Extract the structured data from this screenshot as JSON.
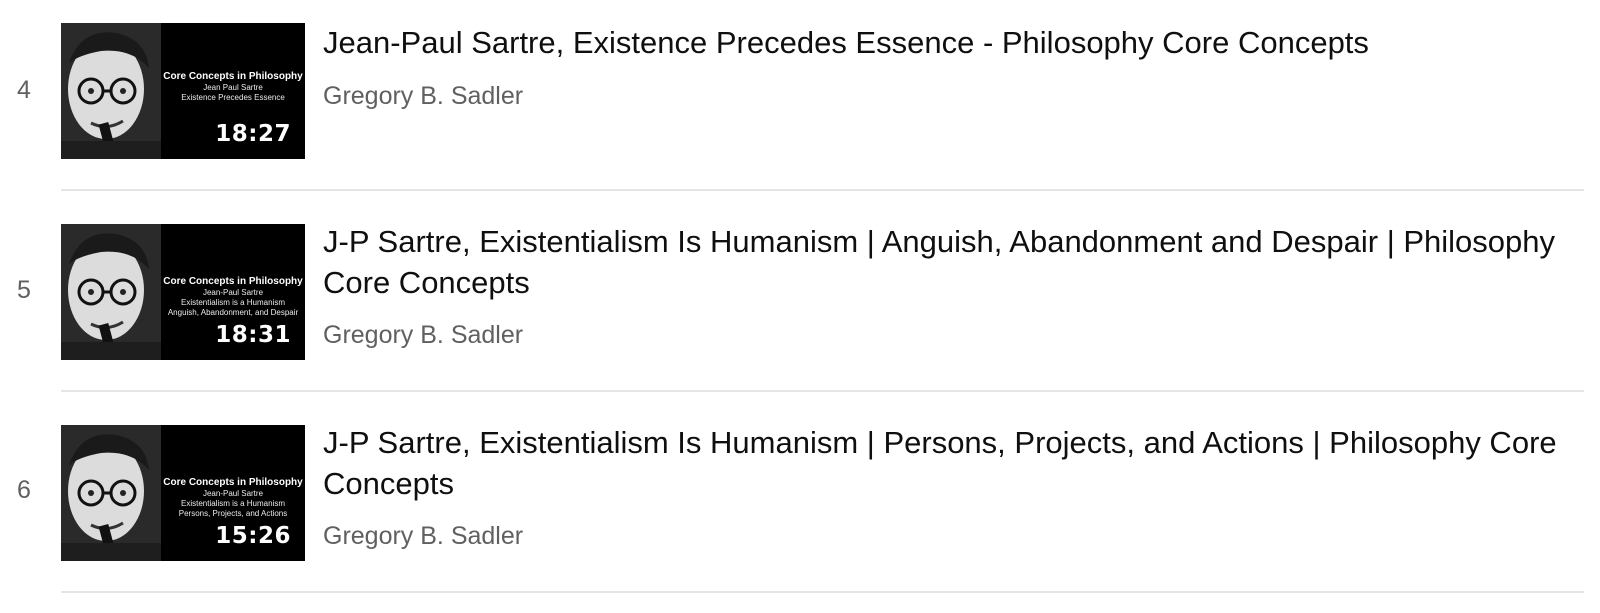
{
  "playlist": {
    "items": [
      {
        "index": "4",
        "title": "Jean-Paul Sartre, Existence Precedes Essence - Philosophy Core Concepts",
        "channel": "Gregory B. Sadler",
        "duration": "18:27",
        "thumbnail": {
          "series": "Core Concepts in Philosophy",
          "lines": [
            "Jean Paul Sartre",
            "Existence Precedes Essence"
          ]
        }
      },
      {
        "index": "5",
        "title": "J-P Sartre, Existentialism Is Humanism | Anguish, Abandonment and Despair | Philosophy Core Concepts",
        "channel": "Gregory B. Sadler",
        "duration": "18:31",
        "thumbnail": {
          "series": "Core Concepts in Philosophy",
          "lines": [
            "Jean-Paul Sartre",
            "Existentialism is a Humanism",
            "Anguish, Abandonment, and Despair"
          ]
        }
      },
      {
        "index": "6",
        "title": "J-P Sartre, Existentialism Is Humanism | Persons, Projects, and Actions | Philosophy Core Concepts",
        "channel": "Gregory B. Sadler",
        "duration": "15:26",
        "thumbnail": {
          "series": "Core Concepts in Philosophy",
          "lines": [
            "Jean-Paul Sartre",
            "Existentialism is a Humanism",
            "Persons, Projects, and Actions"
          ]
        }
      }
    ]
  }
}
